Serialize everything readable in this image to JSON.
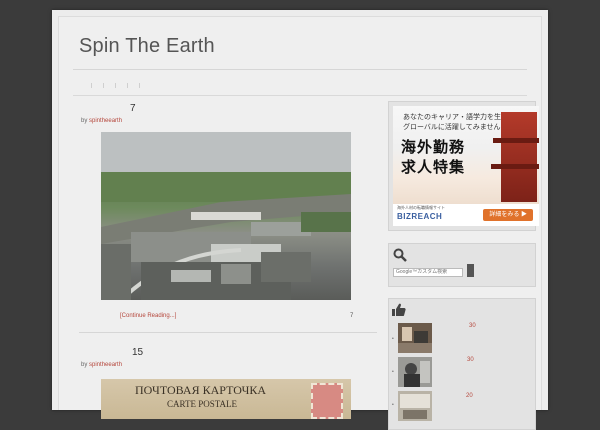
{
  "site": {
    "title": "Spin The Earth"
  },
  "posts": [
    {
      "title": "7",
      "byline_prefix": "by",
      "author": "spintheearth",
      "continue": "[Continue Reading...]",
      "comments": "7"
    },
    {
      "title": "15",
      "byline_prefix": "by",
      "author": "spintheearth",
      "image_text": "ПОЧТОВАЯ КАРТОЧКА",
      "image_subtext": "CARTE POSTALE"
    }
  ],
  "ad": {
    "line1": "あなたのキャリア・語学力を生かし",
    "line2": "グローバルに活躍してみませんか?",
    "big1": "海外勤務",
    "big2": "求人特集",
    "small": "海外人材の転職情報サイト",
    "brand": "BIZREACH",
    "button": "詳細をみる ▶"
  },
  "search": {
    "placeholder": "Google™カスタム検索"
  },
  "popular": {
    "counts": [
      "30",
      "30",
      "20"
    ]
  },
  "colors": {
    "accent": "#b5473c",
    "background": "#3b3b3b",
    "page": "#ececec"
  }
}
